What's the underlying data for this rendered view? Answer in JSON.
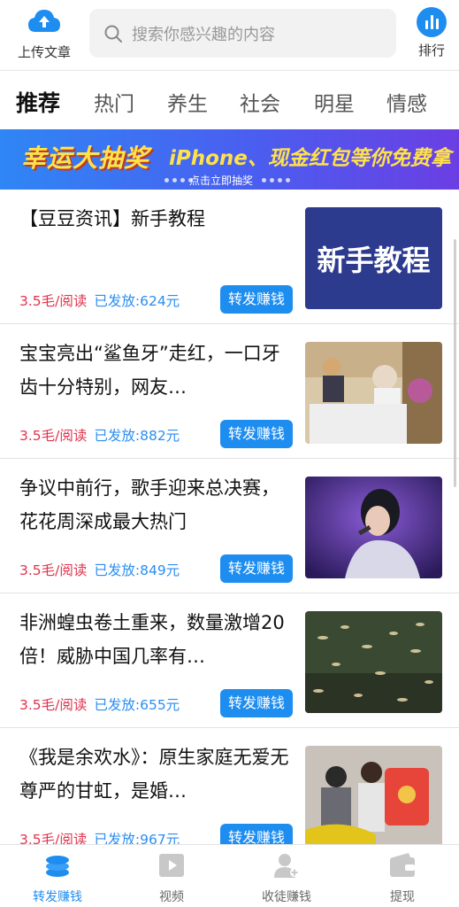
{
  "header": {
    "upload_label": "上传文章",
    "search_placeholder": "搜索你感兴趣的内容",
    "rank_label": "排行"
  },
  "tabs": [
    {
      "label": "推荐",
      "active": true
    },
    {
      "label": "热门",
      "active": false
    },
    {
      "label": "养生",
      "active": false
    },
    {
      "label": "社会",
      "active": false
    },
    {
      "label": "明星",
      "active": false
    },
    {
      "label": "情感",
      "active": false
    }
  ],
  "banner": {
    "title": "幸运大抽奖",
    "subtitle": "iPhone、现金红包等你免费拿",
    "hint": "点击立即抽奖"
  },
  "articles": [
    {
      "title": "【豆豆资讯】新手教程",
      "rate": "3.5毛/阅读",
      "paid": "已发放:624元",
      "button": "转发赚钱",
      "thumb_text": "新手教程"
    },
    {
      "title": "宝宝亮出“鲨鱼牙”走红，一口牙齿十分特别，网友…",
      "rate": "3.5毛/阅读",
      "paid": "已发放:882元",
      "button": "转发赚钱"
    },
    {
      "title": "争议中前行，歌手迎来总决赛，花花周深成最大热门",
      "rate": "3.5毛/阅读",
      "paid": "已发放:849元",
      "button": "转发赚钱"
    },
    {
      "title": "非洲蝗虫卷土重来，数量激增20倍！威胁中国几率有…",
      "rate": "3.5毛/阅读",
      "paid": "已发放:655元",
      "button": "转发赚钱"
    },
    {
      "title": "《我是余欢水》：原生家庭无爱无尊严的甘虹，是婚…",
      "rate": "3.5毛/阅读",
      "paid": "已发放:967元",
      "button": "转发赚钱"
    }
  ],
  "bottom_nav": [
    {
      "label": "转发赚钱",
      "icon": "coins-stack-icon",
      "active": true
    },
    {
      "label": "视频",
      "icon": "play-video-icon",
      "active": false
    },
    {
      "label": "收徒赚钱",
      "icon": "user-add-icon",
      "active": false
    },
    {
      "label": "提现",
      "icon": "wallet-icon",
      "active": false
    }
  ],
  "colors": {
    "accent": "#1e8df0",
    "rate_red": "#e0334d",
    "paid_blue": "#2b8ef0",
    "banner_yellow": "#ffe14a"
  }
}
